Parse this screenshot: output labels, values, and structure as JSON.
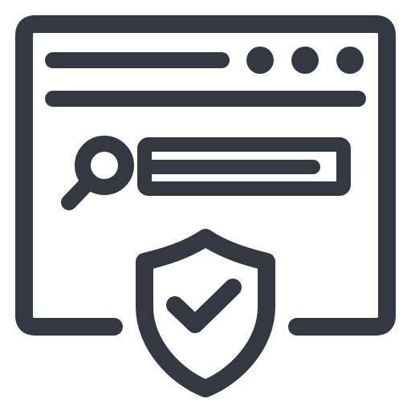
{
  "icon": {
    "name": "secure-web-search-icon",
    "stroke_color": "#343841",
    "background_color": "#ffffff",
    "parts": [
      "browser-window-icon",
      "window-dots-icon",
      "address-bar-icon",
      "search-icon",
      "search-field-icon",
      "shield-check-icon"
    ]
  }
}
